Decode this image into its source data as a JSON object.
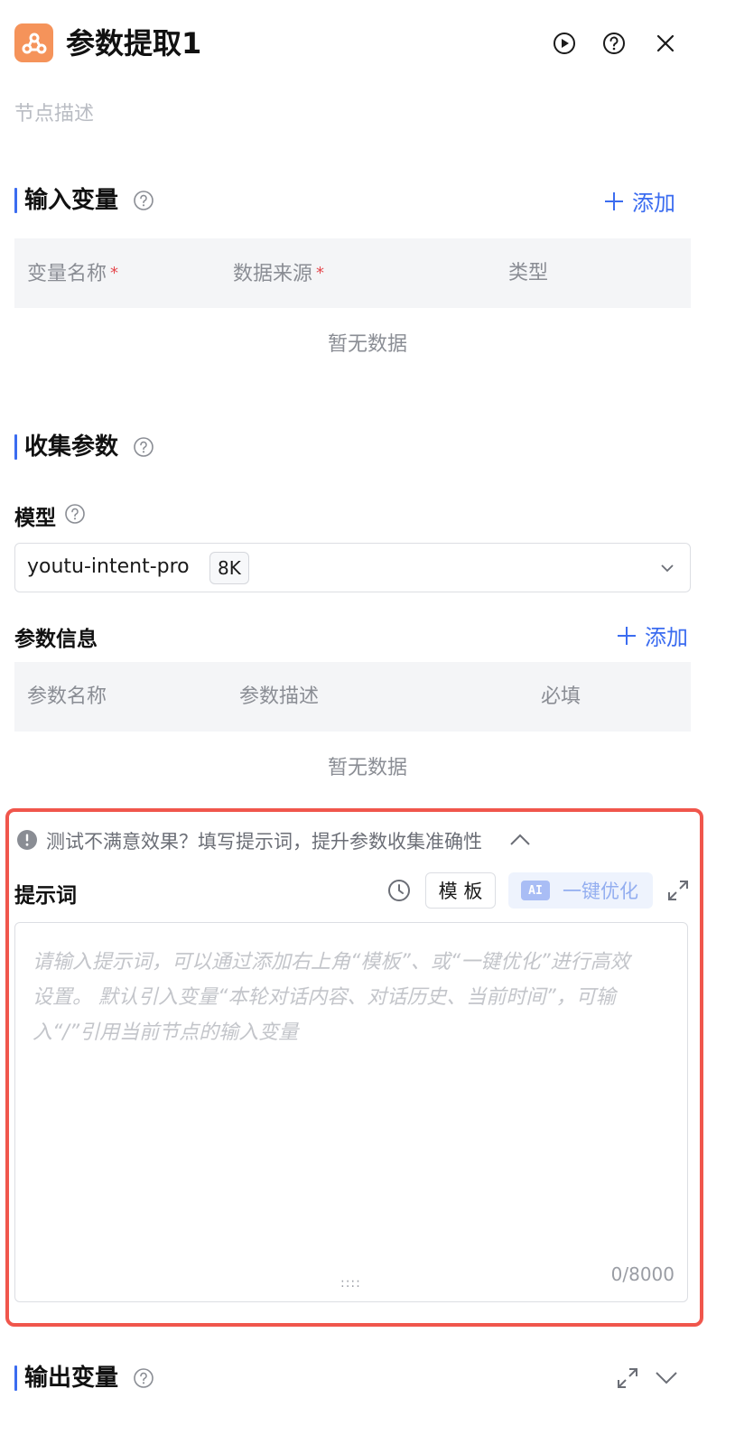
{
  "header": {
    "title": "参数提取1",
    "description_placeholder": "节点描述",
    "icon": "node-logo-icon"
  },
  "input_variables": {
    "title": "输入变量",
    "add_label": "添加",
    "columns": [
      "变量名称",
      "数据来源",
      "类型"
    ],
    "required_mark": "*",
    "empty_text": "暂无数据"
  },
  "collect_params": {
    "title": "收集参数",
    "model_label": "模型",
    "model_value": "youtu-intent-pro",
    "model_context": "8K",
    "param_info_label": "参数信息",
    "add_label": "添加",
    "columns": [
      "参数名称",
      "参数描述",
      "必填"
    ],
    "empty_text": "暂无数据"
  },
  "prompt": {
    "tip": "测试不满意效果？填写提示词，提升参数收集准确性",
    "label": "提示词",
    "template_label": "模 板",
    "ai_badge": "AI",
    "optimize_label": "一键优化",
    "placeholder": "请输入提示词，可以通过添加右上角“模板”、或“一键优化”进行高效设置。 默认引入变量“本轮对话内容、对话历史、当前时间”，可输入“/”引用当前节点的输入变量",
    "counter": "0/8000",
    "grip": "::::"
  },
  "output_variables": {
    "title": "输出变量"
  },
  "colors": {
    "accent": "#3b6cf0",
    "highlight": "#f0564c",
    "brand_icon": "#f5935a"
  }
}
